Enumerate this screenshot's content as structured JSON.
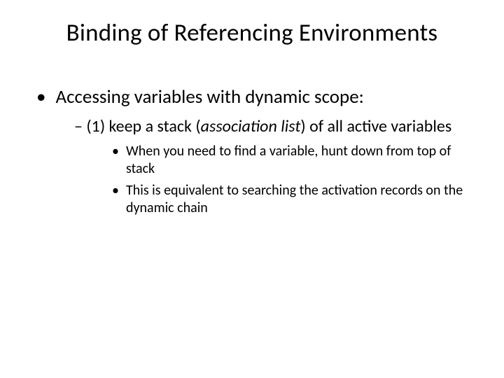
{
  "title": "Binding of Referencing Environments",
  "lvl1": {
    "bullet": "•",
    "text": "Accessing variables with dynamic scope:"
  },
  "lvl2": {
    "dash": "– ",
    "prefix": "(1) keep a stack (",
    "italic": "association list",
    "suffix": ") of all active variables"
  },
  "lvl3a": {
    "bullet": "•",
    "text": "When you need to find a variable, hunt down from top of stack"
  },
  "lvl3b": {
    "bullet": "•",
    "text": "This is equivalent to searching the activation records on the dynamic chain"
  }
}
